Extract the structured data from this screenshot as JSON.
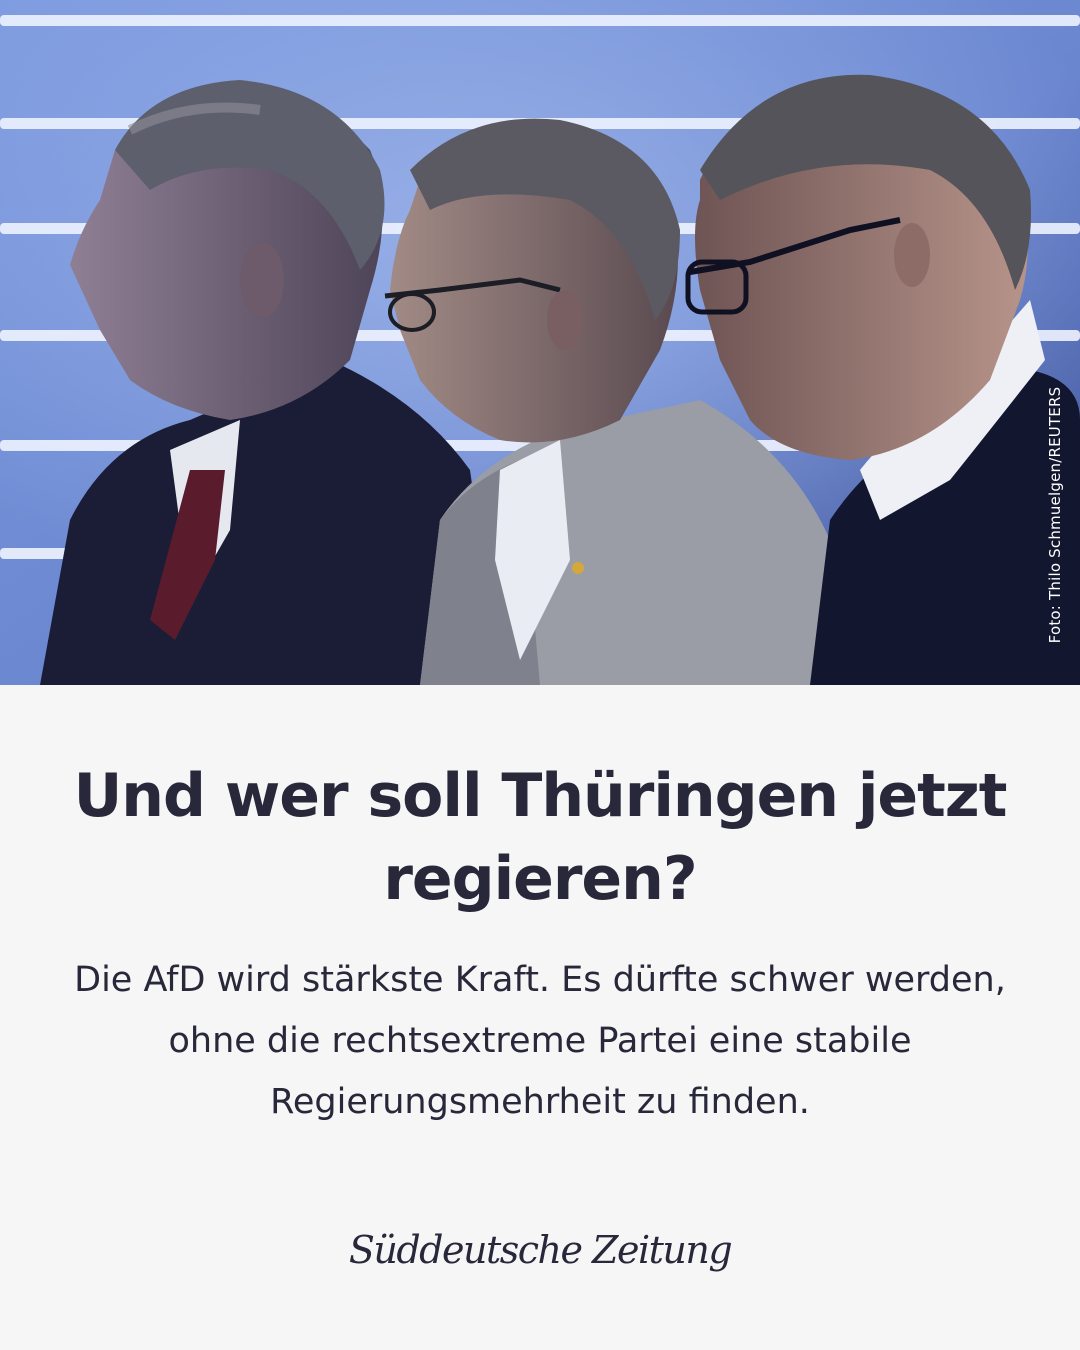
{
  "photo": {
    "description_icon": "photo-three-men-profile",
    "credit": "Foto: Thilo Schmuelgen/REUTERS"
  },
  "article": {
    "headline": "Und wer soll Thüringen jetzt regieren?",
    "subline": "Die AfD wird stärkste Kraft. Es dürfte schwer werden, ohne die rechtsextreme Partei eine stabile Regierungsmehrheit zu finden."
  },
  "brand": {
    "logo_text": "Süddeutsche Zeitung"
  },
  "colors": {
    "text": "#28283a",
    "background": "#f6f6f7",
    "backdrop": "#6f8fd2"
  }
}
